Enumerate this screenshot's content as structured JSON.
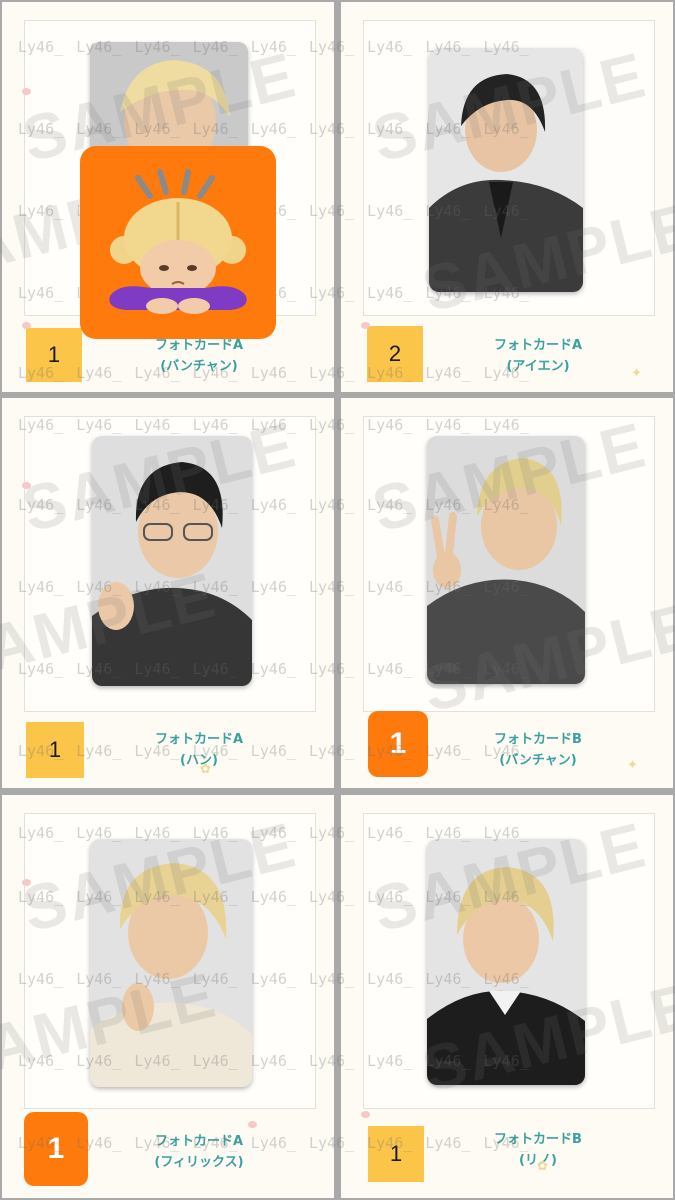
{
  "cards": [
    {
      "kind": "フォトカードA",
      "member": "(バンチャン)",
      "count": "1",
      "badge_style": "yellow"
    },
    {
      "kind": "フォトカードA",
      "member": "(アイエン)",
      "count": "2",
      "badge_style": "yellow"
    },
    {
      "kind": "フォトカードA",
      "member": "(ハン)",
      "count": "1",
      "badge_style": "yellow"
    },
    {
      "kind": "フォトカードB",
      "member": "(バンチャン)",
      "count": "1",
      "badge_style": "orange"
    },
    {
      "kind": "フォトカードA",
      "member": "(フィリックス)",
      "count": "1",
      "badge_style": "orange"
    },
    {
      "kind": "フォトカードB",
      "member": "(リノ)",
      "count": "1",
      "badge_style": "yellow"
    }
  ],
  "watermark": {
    "handle": "Ly46_",
    "sample": "SAMPLE"
  },
  "cover_emoji": "bowing-person-emoji",
  "colors": {
    "caption": "#3aa0a0",
    "badge_yellow": "#fbc54a",
    "badge_orange": "#fe7a0d",
    "divider": "#a9a9a9"
  }
}
